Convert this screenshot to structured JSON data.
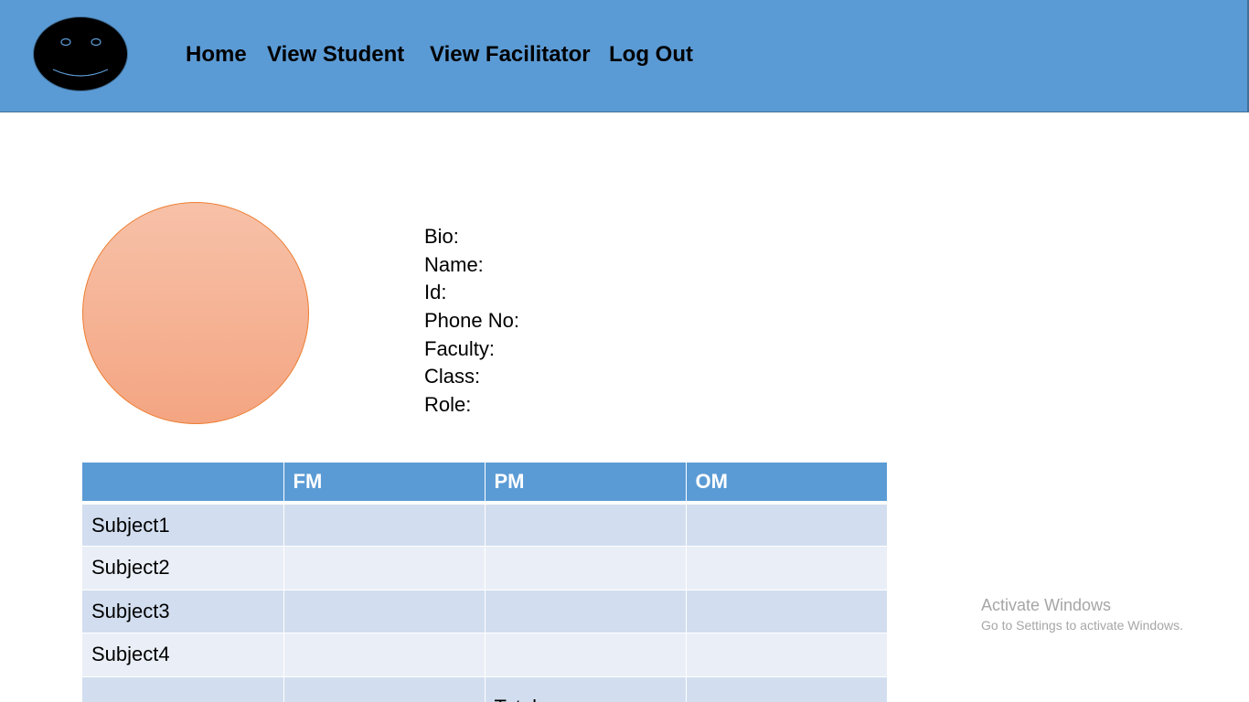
{
  "header": {
    "background_color": "#5b9bd5",
    "logo_icon": "smiley-face-icon",
    "nav": [
      {
        "label": "Home"
      },
      {
        "label": "View Student"
      },
      {
        "label": "View Facilitator"
      },
      {
        "label": "Log Out"
      }
    ]
  },
  "profile": {
    "avatar_color": "#f4b183",
    "fields": [
      {
        "label": "Bio:"
      },
      {
        "label": "Name:"
      },
      {
        "label": "Id:"
      },
      {
        "label": "Phone No:"
      },
      {
        "label": "Faculty:"
      },
      {
        "label": "Class:"
      },
      {
        "label": "Role:"
      }
    ]
  },
  "marks_table": {
    "header_color": "#5b9bd5",
    "columns": [
      "",
      "FM",
      "PM",
      "OM"
    ],
    "rows": [
      [
        "Subject1",
        "",
        "",
        ""
      ],
      [
        "Subject2",
        "",
        "",
        ""
      ],
      [
        "Subject3",
        "",
        "",
        ""
      ],
      [
        "Subject4",
        "",
        "",
        ""
      ],
      [
        "",
        "",
        "Total",
        ""
      ]
    ]
  },
  "watermark": {
    "title": "Activate Windows",
    "subtitle": "Go to Settings to activate Windows."
  }
}
